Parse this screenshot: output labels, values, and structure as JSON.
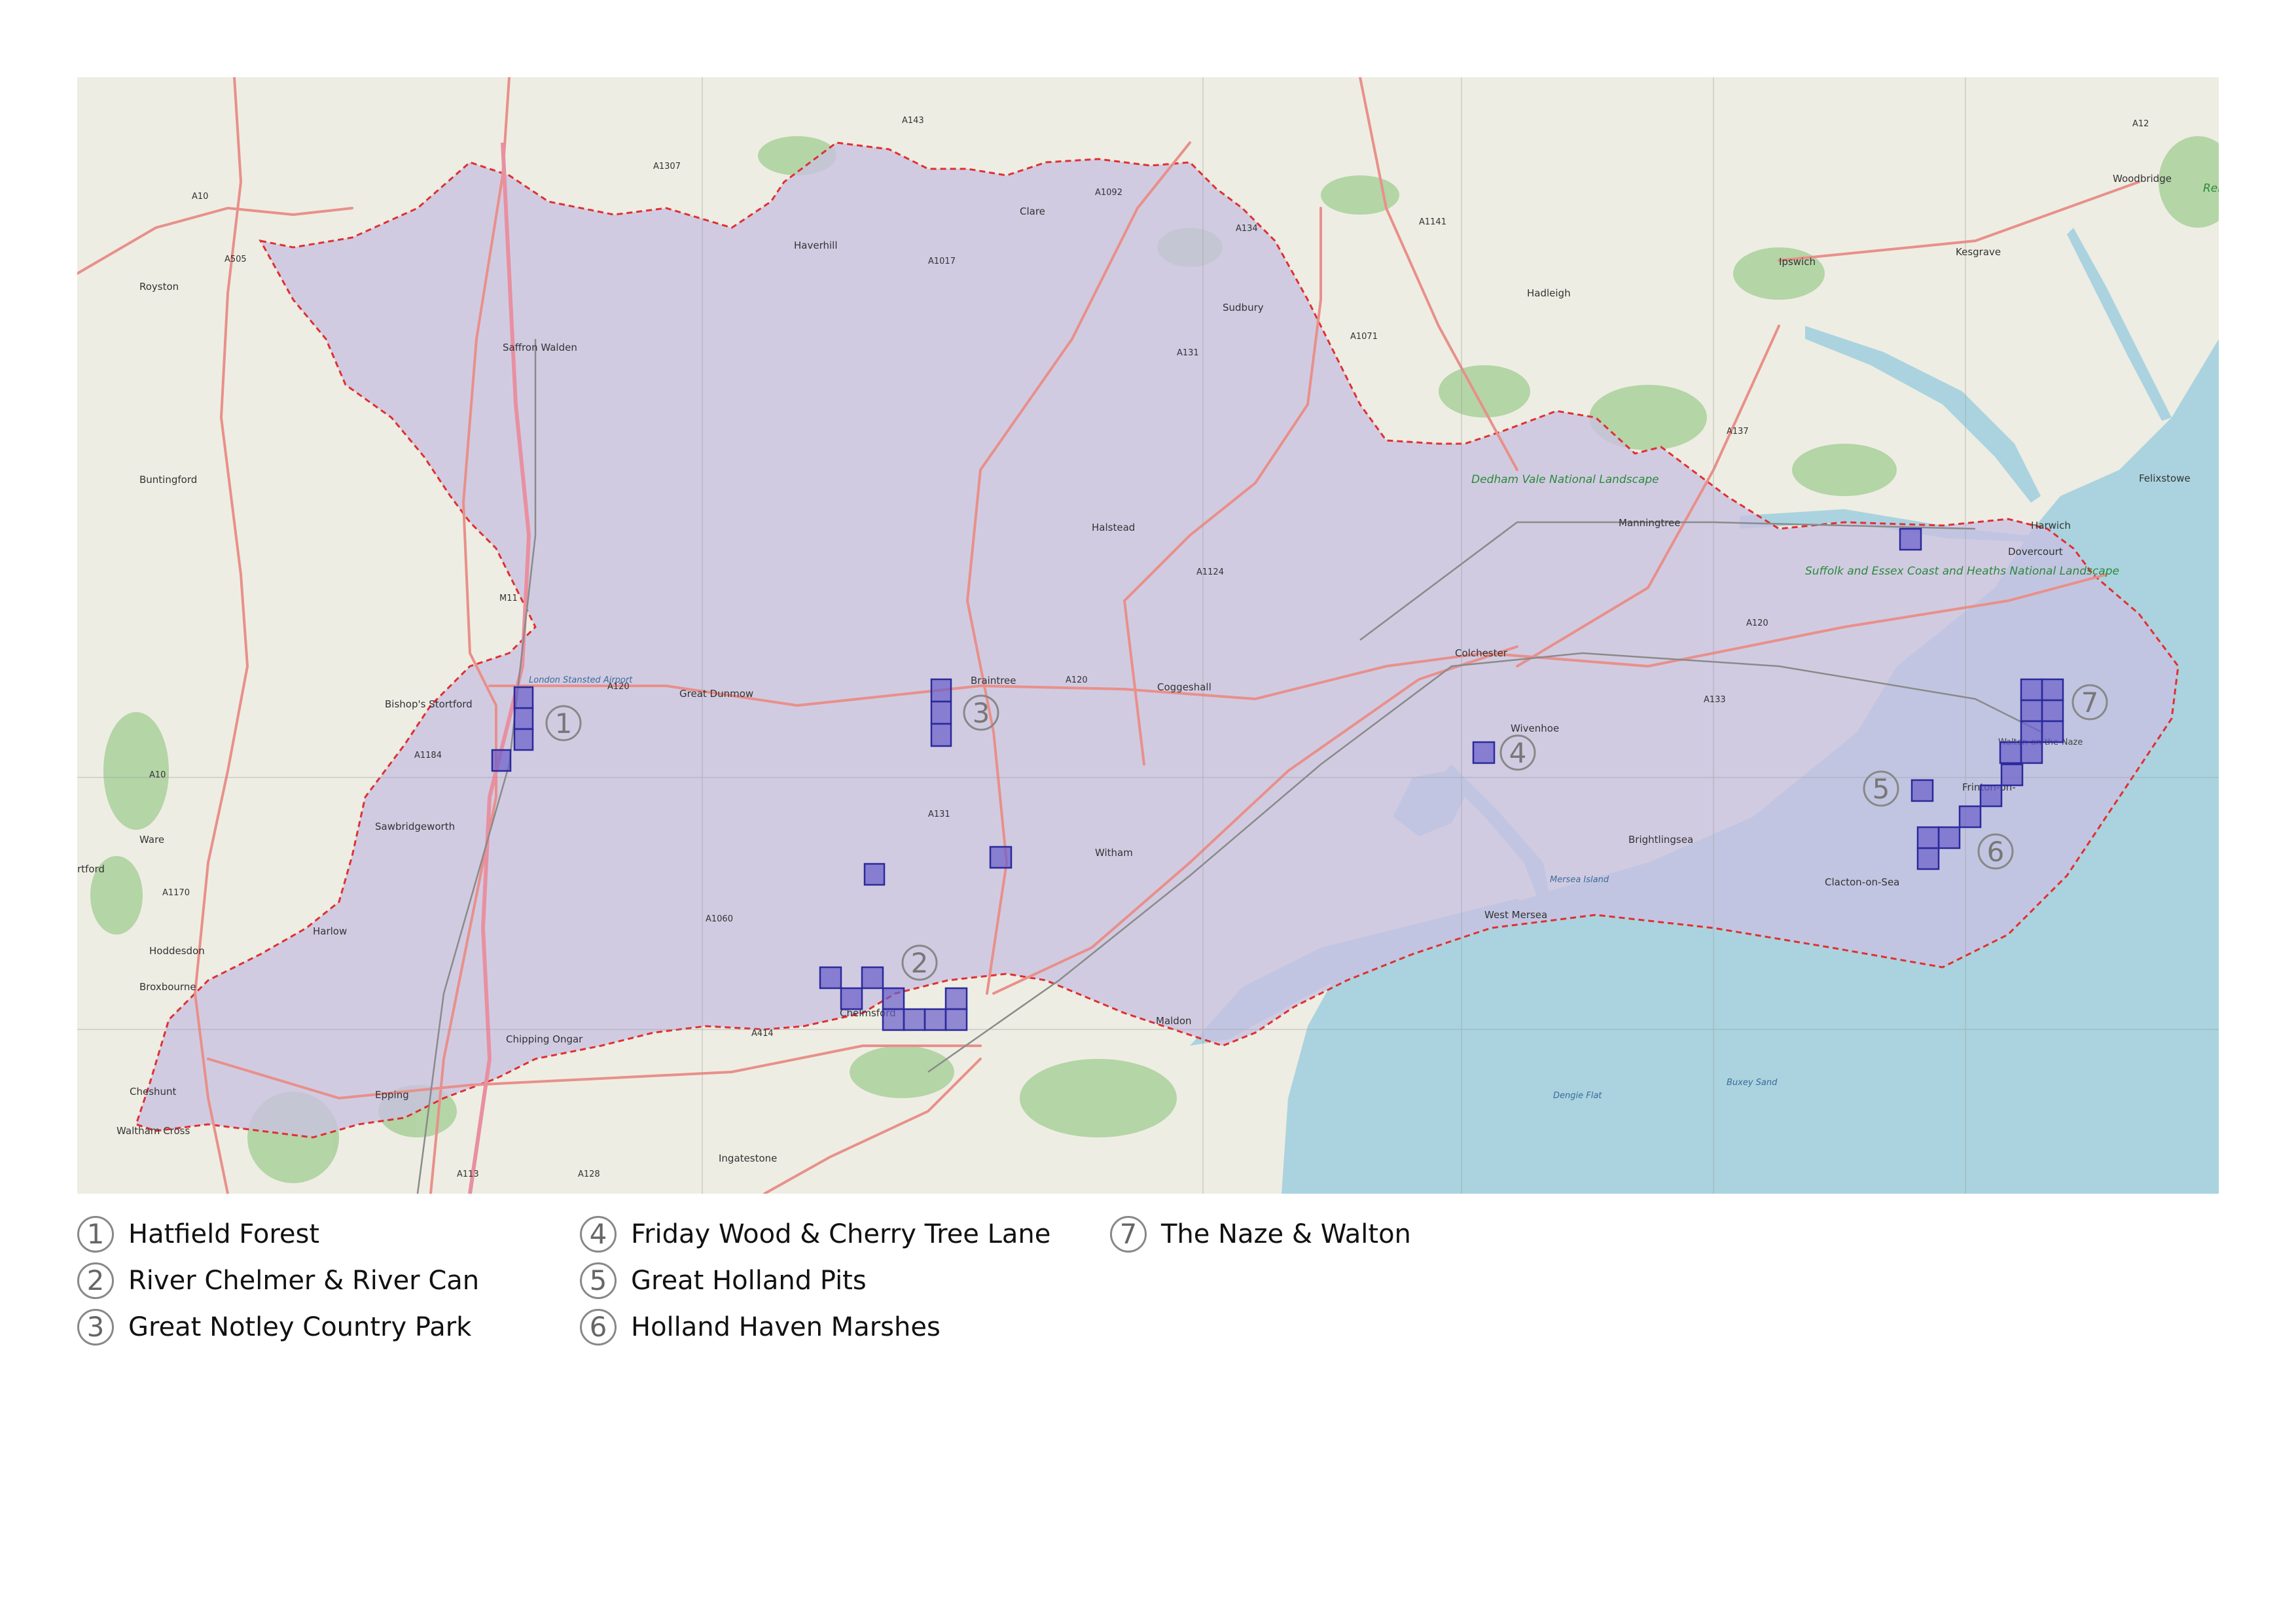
{
  "map": {
    "labels": {
      "royston": "Royston",
      "buntingford": "Buntingford",
      "bishops_stortford": "Bishop's Stortford",
      "sawbridgeworth": "Sawbridgeworth",
      "ware": "Ware",
      "hertford": "rtford",
      "hoddesdon": "Hoddesdon",
      "broxbourne": "Broxbourne",
      "harlow": "Harlow",
      "cheshunt": "Cheshunt",
      "waltham_cross": "Waltham Cross",
      "epping": "Epping",
      "chipping_ongar": "Chipping Ongar",
      "ingatestone": "Ingatestone",
      "saffron_walden": "Saffron Walden",
      "haverhill": "Haverhill",
      "clare": "Clare",
      "sudbury": "Sudbury",
      "hadleigh": "Hadleigh",
      "ipswich": "Ipswich",
      "kesgrave": "Kesgrave",
      "woodbridge": "Woodbridge",
      "felixstowe": "Felixstowe",
      "harwich": "Harwich",
      "dovercourt": "Dovercourt",
      "manningtree": "Manningtree",
      "halstead": "Halstead",
      "great_dunmow": "Great Dunmow",
      "braintree": "Braintree",
      "coggeshall": "Coggeshall",
      "colchester": "Colchester",
      "wivenhoe": "Wivenhoe",
      "witham": "Witham",
      "chelmsford": "Chelmsford",
      "maldon": "Maldon",
      "brightlingsea": "Brightlingsea",
      "west_mersea": "West Mersea",
      "mersea_island": "Mersea Island",
      "clacton": "Clacton-on-Sea",
      "frinton": "Frinton-on-",
      "walton": "Walton-on-the-Naze",
      "london_stansted": "London Stansted Airport",
      "dedham": "Dedham Vale National Landscape",
      "suffolk_coast": "Suffolk and Essex Coast and Heaths National Landscape",
      "dengie_flat": "Dengie Flat",
      "buxey_sand": "Buxey Sand",
      "rendlesham": "Rend",
      "a10": "A10",
      "a505": "A505",
      "a143": "A143",
      "a1307": "A1307",
      "a1092": "A1092",
      "a1017": "A1017",
      "a134": "A134",
      "a131": "A131",
      "a1141": "A1141",
      "a1071": "A1071",
      "a12": "A12",
      "a137": "A137",
      "a120": "A120",
      "a1124": "A1124",
      "a133": "A133",
      "a1184": "A1184",
      "a1170": "A1170",
      "a1060": "A1060",
      "a414": "A414",
      "a113": "A113",
      "a128": "A128",
      "m11": "M11"
    },
    "markers": [
      "1",
      "2",
      "3",
      "4",
      "5",
      "6",
      "7"
    ]
  },
  "legend": [
    {
      "num": "1",
      "label": "Hatfield Forest"
    },
    {
      "num": "2",
      "label": "River Chelmer & River Can"
    },
    {
      "num": "3",
      "label": "Great Notley Country Park"
    },
    {
      "num": "4",
      "label": "Friday Wood & Cherry Tree Lane"
    },
    {
      "num": "5",
      "label": "Great Holland Pits"
    },
    {
      "num": "6",
      "label": "Holland Haven Marshes"
    },
    {
      "num": "7",
      "label": "The Naze & Walton"
    }
  ],
  "colors": {
    "land": "#f1efe6",
    "essex_overlay": "#c9c2e2",
    "boundary": "#e03030",
    "sea": "#aad3df",
    "grid_square_fill": "#6a5ccb",
    "grid_square_stroke": "#2a2a9a",
    "marker": "#888888",
    "road": "#e8908a",
    "woodland": "#a9d39a"
  }
}
